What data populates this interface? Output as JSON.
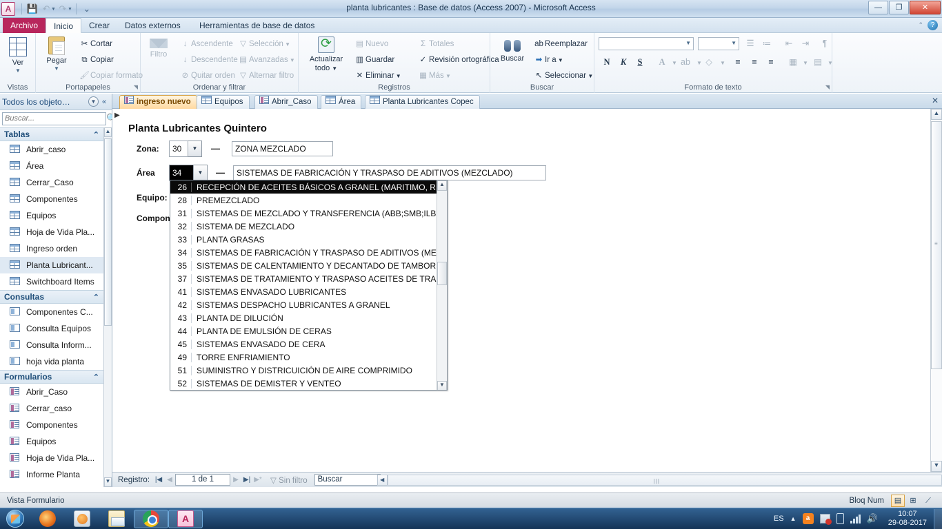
{
  "window": {
    "title": "planta lubricantes : Base de datos (Access 2007)  -  Microsoft Access",
    "app_icon": "A",
    "minimize": "—",
    "restore": "❐",
    "close": "✕",
    "help": "?"
  },
  "quick_access": {
    "save_icon": "save-icon",
    "undo_icon": "undo-icon",
    "redo_icon": "redo-icon",
    "customize_icon": "customize-icon"
  },
  "ribbon": {
    "tabs": [
      {
        "label": "Archivo",
        "type": "file"
      },
      {
        "label": "Inicio",
        "active": true
      },
      {
        "label": "Crear",
        "active": false
      },
      {
        "label": "Datos externos",
        "active": false
      },
      {
        "label": "Herramientas de base de datos",
        "active": false
      }
    ],
    "groups": [
      {
        "name": "Vistas",
        "title": "Vistas"
      },
      {
        "name": "Portapapeles",
        "title": "Portapapeles"
      },
      {
        "name": "Ordenar y filtrar",
        "title": "Ordenar y filtrar"
      },
      {
        "name": "Registros",
        "title": "Registros"
      },
      {
        "name": "Buscar",
        "title": "Buscar"
      },
      {
        "name": "Formato de texto",
        "title": "Formato de texto"
      }
    ],
    "vistas": {
      "ver": "Ver",
      "caret": "▼"
    },
    "portapapeles": {
      "pegar": "Pegar",
      "pegar_caret": "▼",
      "cortar": "Cortar",
      "copiar": "Copiar",
      "copiar_formato": "Copiar formato"
    },
    "ordenar": {
      "filtro": "Filtro",
      "ascendente": "Ascendente",
      "descendente": "Descendente",
      "quitar_orden": "Quitar orden",
      "seleccion": "Selección",
      "avanzadas": "Avanzadas",
      "alternar_filtro": "Alternar filtro"
    },
    "registros": {
      "actualizar_todo_l1": "Actualizar",
      "actualizar_todo_l2": "todo",
      "actualizar_caret": "▼",
      "nuevo": "Nuevo",
      "guardar": "Guardar",
      "eliminar": "Eliminar",
      "totales": "Totales",
      "revision": "Revisión ortográfica",
      "mas": "Más"
    },
    "buscar": {
      "buscar": "Buscar",
      "reemplazar": "Reemplazar",
      "ir_a": "Ir a",
      "seleccionar": "Seleccionar"
    },
    "formato": {
      "font_name": "",
      "font_size": "",
      "negrita": "N",
      "cursiva": "K",
      "subrayado": "S",
      "color_texto": "A",
      "resaltado": "ab",
      "relleno": "◇",
      "align_left": "≡",
      "align_center": "≡",
      "align_right": "≡",
      "bullets_icon": "bullets-icon",
      "numbering_icon": "numbering-icon",
      "indent_dec_icon": "decrease-indent-icon",
      "indent_inc_icon": "increase-indent-icon",
      "rtl_icon": "text-direction-icon",
      "grid_icon": "gridlines-icon",
      "altfill_icon": "alternate-fill-icon"
    }
  },
  "navpane": {
    "header_title": "Todos los objeto…",
    "dropdown_icon": "chevron-down-icon",
    "collapse_icon": "double-chevron-left-icon",
    "search_placeholder": "Buscar...",
    "search_value": "",
    "search_icon": "search-icon",
    "groups": [
      {
        "label": "Tablas",
        "icon": "table-icon",
        "items": [
          "Abrir_caso",
          "Área",
          "Cerrar_Caso",
          "Componentes",
          "Equipos",
          "Hoja de Vida Pla...",
          "Ingreso orden",
          "Planta Lubricant...",
          "Switchboard Items"
        ],
        "selected": "Planta Lubricant..."
      },
      {
        "label": "Consultas",
        "icon": "query-icon",
        "items": [
          "Componentes C...",
          "Consulta Equipos",
          "Consulta Inform...",
          "hoja vida planta"
        ],
        "selected": ""
      },
      {
        "label": "Formularios",
        "icon": "form-icon",
        "items": [
          "Abrir_Caso",
          "Cerrar_caso",
          "Componentes",
          "Equipos",
          "Hoja de Vida Pla...",
          "Informe Planta"
        ],
        "selected": ""
      }
    ]
  },
  "doctabs": {
    "tabs": [
      {
        "label": "ingreso nuevo",
        "icon": "form-icon",
        "active": true
      },
      {
        "label": "Equipos",
        "icon": "table-icon",
        "active": false
      },
      {
        "label": "Abrir_Caso",
        "icon": "form-icon",
        "active": false
      },
      {
        "label": "Área",
        "icon": "table-icon",
        "active": false
      },
      {
        "label": "Planta Lubricantes Copec",
        "icon": "table-icon",
        "active": false
      }
    ],
    "close_label": "✕"
  },
  "form": {
    "title": "Planta Lubricantes Quintero",
    "zona_label": "Zona:",
    "zona_value": "30",
    "zona_dash": "—",
    "zona_text": "ZONA MEZCLADO",
    "area_label": "Área",
    "area_value": "34",
    "area_dash": "—",
    "area_text": "SISTEMAS DE FABRICACIÓN Y TRASPASO DE ADITIVOS (MEZCLADO)",
    "equipo_label": "Equipo:",
    "componente_label": "Compon",
    "combo_arrow": "▼"
  },
  "dropdown": {
    "open": true,
    "selected_index": 0,
    "scroll_up_icon": "▲",
    "scroll_down_icon": "▼",
    "options": [
      {
        "id": "26",
        "name": "RECEPCIÓN DE ACEITES BÁSICOS A GRANEL (MARITIMO, RE"
      },
      {
        "id": "28",
        "name": "PREMEZCLADO"
      },
      {
        "id": "31",
        "name": "SISTEMAS DE MEZCLADO Y TRANSFERENCIA (ABB;SMB;ILB;"
      },
      {
        "id": "32",
        "name": "SISTEMA DE MEZCLADO"
      },
      {
        "id": "33",
        "name": "PLANTA GRASAS"
      },
      {
        "id": "34",
        "name": "SISTEMAS DE FABRICACIÓN Y TRASPASO DE ADITIVOS (ME"
      },
      {
        "id": "35",
        "name": "SISTEMAS DE CALENTAMIENTO Y DECANTADO DE TAMBOR"
      },
      {
        "id": "37",
        "name": "SISTEMAS DE TRATAMIENTO Y TRASPASO ACEITES DE TRAN"
      },
      {
        "id": "41",
        "name": "SISTEMAS ENVASADO LUBRICANTES"
      },
      {
        "id": "42",
        "name": "SISTEMAS DESPACHO LUBRICANTES A GRANEL"
      },
      {
        "id": "43",
        "name": "PLANTA DE DILUCIÓN"
      },
      {
        "id": "44",
        "name": "PLANTA DE EMULSIÓN DE CERAS"
      },
      {
        "id": "45",
        "name": "SISTEMAS ENVASADO DE CERA"
      },
      {
        "id": "49",
        "name": "TORRE ENFRIAMIENTO"
      },
      {
        "id": "51",
        "name": "SUMINISTRO Y DISTRICUICIÓN DE AIRE COMPRIMIDO"
      },
      {
        "id": "52",
        "name": "SISTEMAS DE DEMISTER Y VENTEO"
      }
    ]
  },
  "record_nav": {
    "label": "Registro:",
    "first": "|◀",
    "prev": "◀",
    "position": "1 de 1",
    "next": "▶",
    "last": "▶|",
    "new": "▶*",
    "filter_icon": "filter-icon",
    "filter_label": "Sin filtro",
    "search_value": "Buscar"
  },
  "statusbar": {
    "view_mode": "Vista Formulario",
    "num_lock": "Bloq Num",
    "view_buttons": [
      {
        "name": "form-view-button",
        "glyph": "▤",
        "active": true
      },
      {
        "name": "layout-view-button",
        "glyph": "⊞",
        "active": false
      },
      {
        "name": "design-view-button",
        "glyph": "⟋",
        "active": false
      }
    ]
  },
  "taskbar": {
    "start_icon": "windows-start-icon",
    "items": [
      {
        "name": "firefox-icon",
        "open": false
      },
      {
        "name": "media-player-icon",
        "open": false
      },
      {
        "name": "file-explorer-icon",
        "open": false
      },
      {
        "name": "chrome-icon",
        "open": true
      },
      {
        "name": "access-icon",
        "open": true
      }
    ],
    "tray": {
      "language": "ES",
      "show_hidden": "▲",
      "avast_icon": "avast-icon",
      "action_center_icon": "action-center-flag-icon",
      "battery_icon": "battery-icon",
      "network_icon": "network-signal-icon",
      "volume_icon": "volume-icon",
      "time": "10:07",
      "date": "29-08-2017"
    }
  }
}
